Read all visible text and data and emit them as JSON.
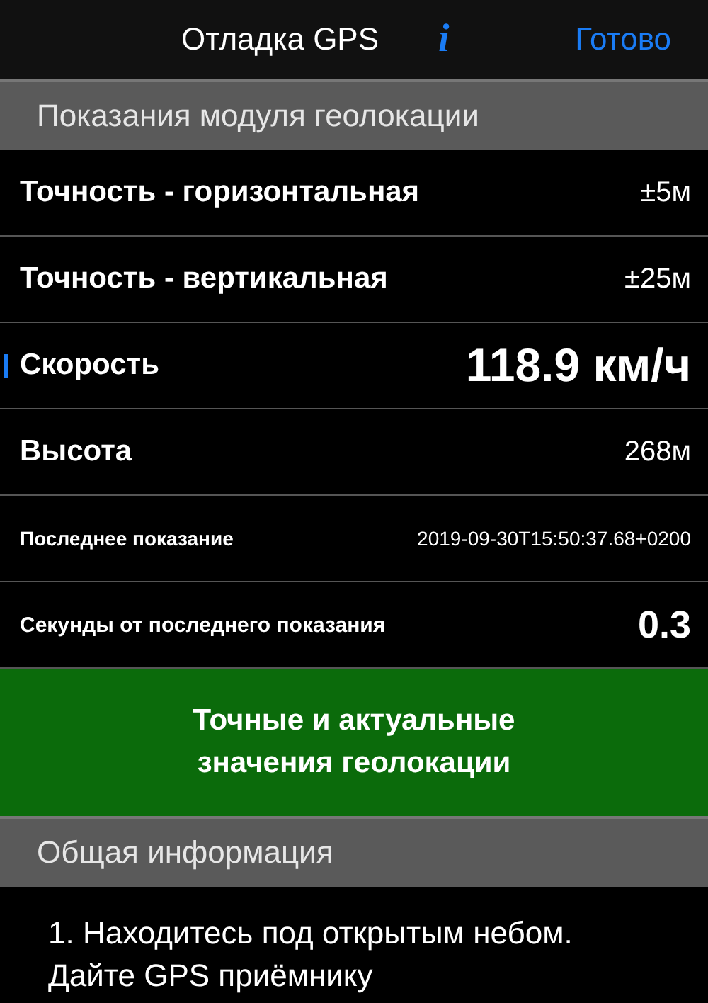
{
  "nav": {
    "title": "Отладка GPS",
    "info": "i",
    "done": "Готово"
  },
  "sections": [
    {
      "header": "Показания модуля геолокации"
    },
    {
      "header": "Общая информация"
    }
  ],
  "readings": [
    {
      "kind": "standard",
      "label": "Точность - горизонтальная",
      "value": "±5м",
      "selected": false
    },
    {
      "kind": "standard",
      "label": "Точность - вертикальная",
      "value": "±25м",
      "selected": false
    },
    {
      "kind": "speed",
      "label": "Скорость",
      "value": "118.9 км/ч",
      "selected": true
    },
    {
      "kind": "standard",
      "label": "Высота",
      "value": "268м",
      "selected": false
    },
    {
      "kind": "timestamp",
      "label": "Последнее показание",
      "value": "2019-09-30T15:50:37.68+0200",
      "selected": false
    },
    {
      "kind": "elapsed",
      "label": "Секунды от последнего показания",
      "value": "0.3",
      "selected": false
    }
  ],
  "status": {
    "kind": "ok",
    "text": "Точные и актуальные\nзначения геолокации"
  },
  "info_text": "1. Находитесь под открытым небом. Дайте GPS приёмнику"
}
